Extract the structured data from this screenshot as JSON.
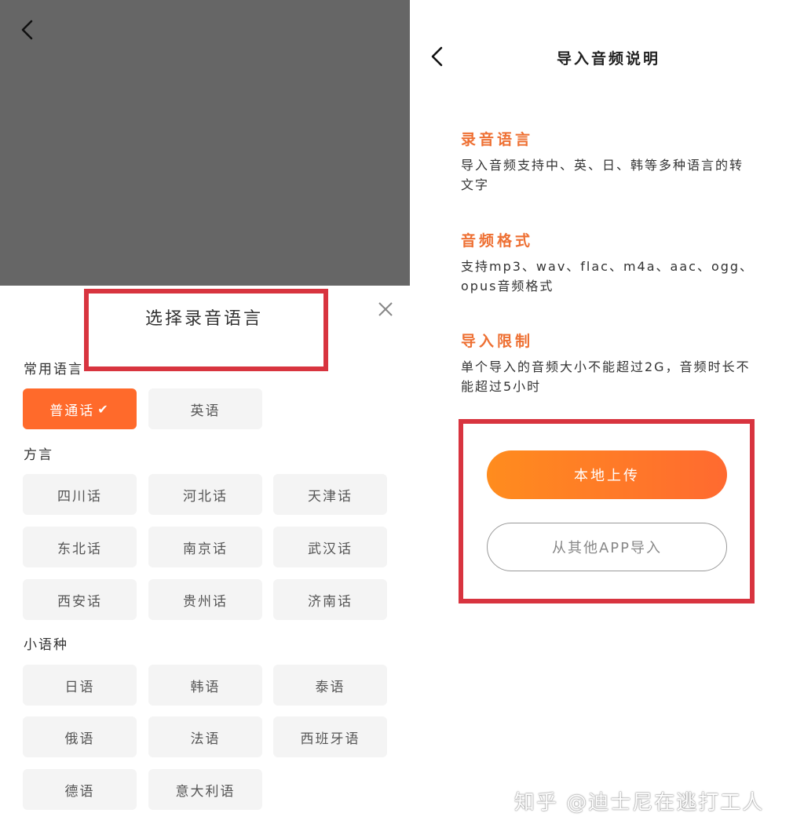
{
  "left": {
    "sheet_title": "选择录音语言",
    "sections": [
      {
        "label": "常用语言",
        "chips": [
          {
            "label": "普通话",
            "selected": true
          },
          {
            "label": "英语",
            "selected": false
          }
        ]
      },
      {
        "label": "方言",
        "chips": [
          {
            "label": "四川话"
          },
          {
            "label": "河北话"
          },
          {
            "label": "天津话"
          },
          {
            "label": "东北话"
          },
          {
            "label": "南京话"
          },
          {
            "label": "武汉话"
          },
          {
            "label": "西安话"
          },
          {
            "label": "贵州话"
          },
          {
            "label": "济南话"
          }
        ]
      },
      {
        "label": "小语种",
        "chips": [
          {
            "label": "日语"
          },
          {
            "label": "韩语"
          },
          {
            "label": "泰语"
          },
          {
            "label": "俄语"
          },
          {
            "label": "法语"
          },
          {
            "label": "西班牙语"
          },
          {
            "label": "德语"
          },
          {
            "label": "意大利语"
          }
        ]
      }
    ]
  },
  "right": {
    "title": "导入音频说明",
    "blocks": [
      {
        "heading": "录音语言",
        "text": "导入音频支持中、英、日、韩等多种语言的转文字"
      },
      {
        "heading": "音频格式",
        "text": "支持mp3、wav、flac、m4a、aac、ogg、opus音频格式"
      },
      {
        "heading": "导入限制",
        "text": "单个导入的音频大小不能超过2G，音频时长不能超过5小时"
      }
    ],
    "primary_button": "本地上传",
    "secondary_button": "从其他APP导入"
  },
  "watermark": "知乎 @迪士尼在逃打工人",
  "colors": {
    "accent": "#ff6a2b",
    "heading": "#ee7033",
    "highlight": "#d8343f",
    "overlay": "#666666"
  },
  "icons": {
    "back": "chevron-left-icon",
    "close": "close-icon",
    "check": "checkmark-icon"
  }
}
